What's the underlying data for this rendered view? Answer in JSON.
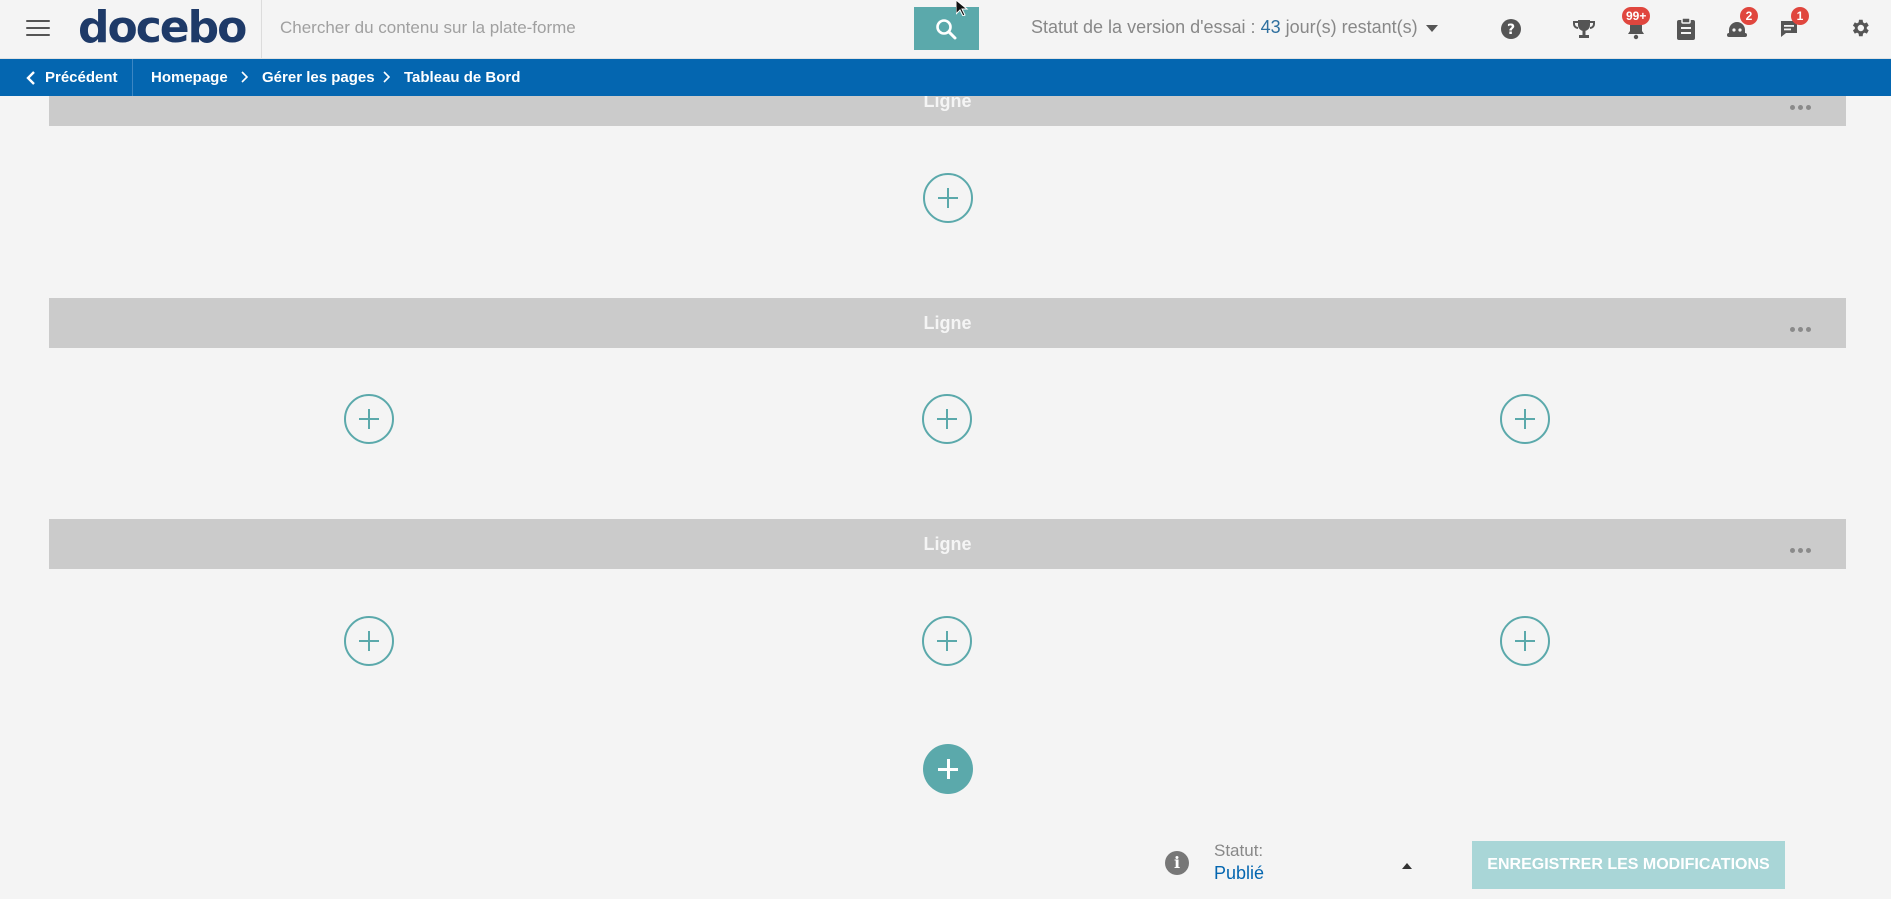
{
  "app": {
    "logo_text": "docebo"
  },
  "search": {
    "placeholder": "Chercher du contenu sur la plate-forme"
  },
  "trial": {
    "prefix": "Statut de la version d'essai : ",
    "days": "43",
    "suffix": " jour(s) restant(s)"
  },
  "header_icons": [
    {
      "name": "help-icon"
    },
    {
      "name": "trophy-icon"
    },
    {
      "name": "notifications-icon",
      "badge": "99+"
    },
    {
      "name": "clipboard-icon"
    },
    {
      "name": "assistant-icon",
      "badge": "2"
    },
    {
      "name": "messages-icon",
      "badge": "1"
    },
    {
      "name": "settings-icon"
    }
  ],
  "breadcrumb": {
    "back_label": "Précédent",
    "items": [
      "Homepage",
      "Gérer les pages",
      "Tableau de Bord"
    ]
  },
  "rows": [
    {
      "label": "Ligne",
      "slots": 1
    },
    {
      "label": "Ligne",
      "slots": 3
    },
    {
      "label": "Ligne",
      "slots": 3
    }
  ],
  "footer": {
    "status_label": "Statut:",
    "status_value": "Publié",
    "save_label": "ENREGISTRER LES MODIFICATIONS"
  },
  "colors": {
    "accent": "#5ba9ab",
    "brand_blue": "#0466b0",
    "badge_red": "#e0463e"
  }
}
